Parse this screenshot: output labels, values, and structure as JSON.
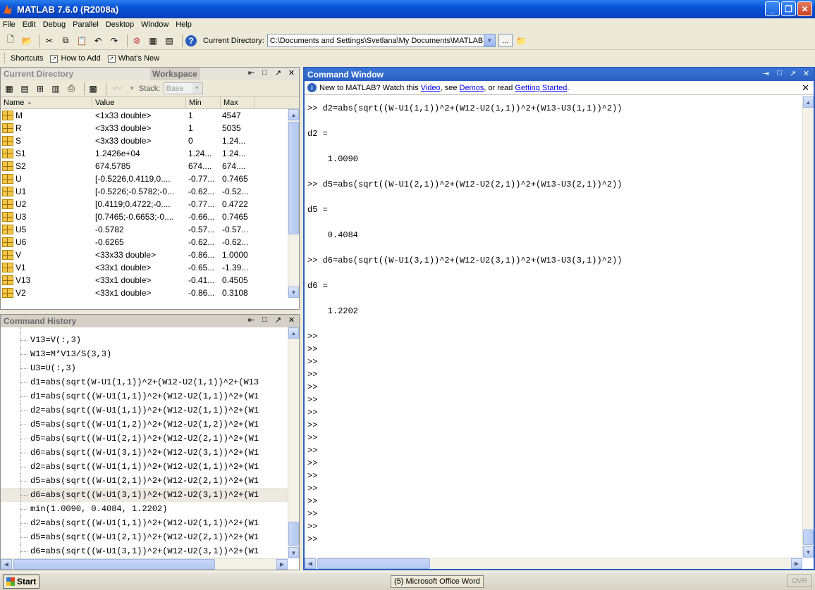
{
  "window": {
    "title": "MATLAB  7.6.0 (R2008a)"
  },
  "menu": [
    "File",
    "Edit",
    "Debug",
    "Parallel",
    "Desktop",
    "Window",
    "Help"
  ],
  "toolbar": {
    "current_dir_label": "Current Directory:",
    "current_dir_value": "C:\\Documents and Settings\\Svetlana\\My Documents\\MATLAB",
    "browse_label": "..."
  },
  "shortcuts": {
    "label": "Shortcuts",
    "how_to_add": "How to Add",
    "whats_new": "What's New"
  },
  "workspace": {
    "tab_current_dir": "Current Directory",
    "tab_workspace": "Workspace",
    "stack_label": "Stack:",
    "stack_value": "Base",
    "columns": [
      "Name",
      "Value",
      "Min",
      "Max"
    ],
    "rows": [
      {
        "name": "M",
        "value": "<1x33 double>",
        "min": "1",
        "max": "4547"
      },
      {
        "name": "R",
        "value": "<3x33 double>",
        "min": "1",
        "max": "5035"
      },
      {
        "name": "S",
        "value": "<3x33 double>",
        "min": "0",
        "max": "1.24..."
      },
      {
        "name": "S1",
        "value": "1.2426e+04",
        "min": "1.24...",
        "max": "1.24..."
      },
      {
        "name": "S2",
        "value": "674.5785",
        "min": "674....",
        "max": "674...."
      },
      {
        "name": "U",
        "value": "[-0.5226,0.4119,0....",
        "min": "-0.77...",
        "max": "0.7465"
      },
      {
        "name": "U1",
        "value": "[-0.5226;-0.5782;-0...",
        "min": "-0.62...",
        "max": "-0.52..."
      },
      {
        "name": "U2",
        "value": "[0.4119;0.4722;-0....",
        "min": "-0.77...",
        "max": "0.4722"
      },
      {
        "name": "U3",
        "value": "[0.7465;-0.6653;-0....",
        "min": "-0.66...",
        "max": "0.7465"
      },
      {
        "name": "U5",
        "value": "-0.5782",
        "min": "-0.57...",
        "max": "-0.57..."
      },
      {
        "name": "U6",
        "value": "-0.6265",
        "min": "-0.62...",
        "max": "-0.62..."
      },
      {
        "name": "V",
        "value": "<33x33 double>",
        "min": "-0.86...",
        "max": "1.0000"
      },
      {
        "name": "V1",
        "value": "<33x1 double>",
        "min": "-0.65...",
        "max": "-1.39..."
      },
      {
        "name": "V13",
        "value": "<33x1 double>",
        "min": "-0.41...",
        "max": "0.4505"
      },
      {
        "name": "V2",
        "value": "<33x1 double>",
        "min": "-0.86...",
        "max": "0.3108"
      }
    ]
  },
  "history": {
    "title": "Command History",
    "lines": [
      "V13=V(:,3)",
      "W13=M*V13/S(3,3)",
      "U3=U(:,3)",
      "d1=abs(sqrt(W-U1(1,1))^2+(W12-U2(1,1))^2+(W13",
      "d1=abs(sqrt((W-U1(1,1))^2+(W12-U2(1,1))^2+(W1",
      "d2=abs(sqrt((W-U1(1,1))^2+(W12-U2(1,1))^2+(W1",
      "d5=abs(sqrt((W-U1(1,2))^2+(W12-U2(1,2))^2+(W1",
      "d5=abs(sqrt((W-U1(2,1))^2+(W12-U2(2,1))^2+(W1",
      "d6=abs(sqrt((W-U1(3,1))^2+(W12-U2(3,1))^2+(W1",
      "d2=abs(sqrt((W-U1(1,1))^2+(W12-U2(1,1))^2+(W1",
      "d5=abs(sqrt((W-U1(2,1))^2+(W12-U2(2,1))^2+(W1",
      "d6=abs(sqrt((W-U1(3,1))^2+(W12-U2(3,1))^2+(W1",
      "min(1.0090, 0.4084, 1.2202)",
      "d2=abs(sqrt((W-U1(1,1))^2+(W12-U2(1,1))^2+(W1",
      "d5=abs(sqrt((W-U1(2,1))^2+(W12-U2(2,1))^2+(W1",
      "d6=abs(sqrt((W-U1(3,1))^2+(W12-U2(3,1))^2+(W1"
    ]
  },
  "command_window": {
    "title": "Command Window",
    "info_prefix": "New to MATLAB? Watch this ",
    "info_video": "Video",
    "info_mid1": ", see ",
    "info_demos": "Demos",
    "info_mid2": ", or read ",
    "info_getting_started": "Getting Started",
    "info_suffix": ".",
    "lines": [
      ">> d2=abs(sqrt((W-U1(1,1))^2+(W12-U2(1,1))^2+(W13-U3(1,1))^2))",
      "",
      "d2 =",
      "",
      "    1.0090",
      "",
      ">> d5=abs(sqrt((W-U1(2,1))^2+(W12-U2(2,1))^2+(W13-U3(2,1))^2))",
      "",
      "d5 =",
      "",
      "    0.4084",
      "",
      ">> d6=abs(sqrt((W-U1(3,1))^2+(W12-U2(3,1))^2+(W13-U3(3,1))^2))",
      "",
      "d6 =",
      "",
      "    1.2202",
      "",
      ">>",
      ">>",
      ">>",
      ">>",
      ">>",
      ">>",
      ">>",
      ">>",
      ">>",
      ">>",
      ">>",
      ">>",
      ">>",
      ">>",
      ">>",
      ">>",
      ">>"
    ]
  },
  "taskbar": {
    "start": "Start",
    "task": "(5) Microsoft Office Word",
    "ovr": "OVR"
  }
}
